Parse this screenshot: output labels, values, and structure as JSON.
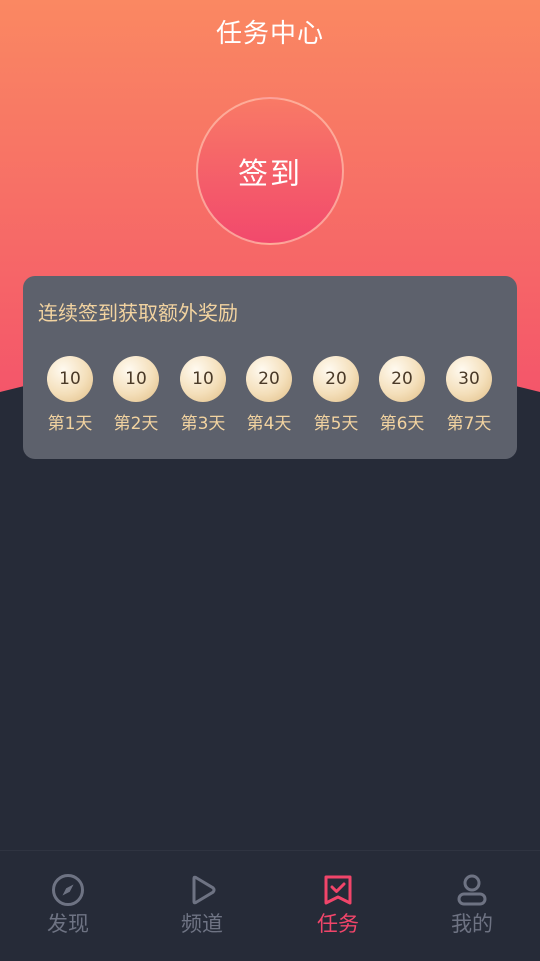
{
  "header": {
    "title": "任务中心"
  },
  "sign_in": {
    "label": "签到"
  },
  "reward": {
    "title": "连续签到获取额外奖励",
    "days": [
      {
        "points": "10",
        "label": "第1天"
      },
      {
        "points": "10",
        "label": "第2天"
      },
      {
        "points": "10",
        "label": "第3天"
      },
      {
        "points": "20",
        "label": "第4天"
      },
      {
        "points": "20",
        "label": "第5天"
      },
      {
        "points": "20",
        "label": "第6天"
      },
      {
        "points": "30",
        "label": "第7天"
      }
    ]
  },
  "tabbar": {
    "items": [
      {
        "label": "发现",
        "icon": "compass-icon",
        "active": false
      },
      {
        "label": "频道",
        "icon": "play-icon",
        "active": false
      },
      {
        "label": "任务",
        "icon": "task-check-icon",
        "active": true
      },
      {
        "label": "我的",
        "icon": "user-icon",
        "active": false
      }
    ]
  },
  "colors": {
    "header_gradient_top": "#fa8862",
    "header_gradient_bottom": "#f4566a",
    "background": "#262b38",
    "card": "#5d616c",
    "gold_text": "#f2d3a0",
    "active_tab": "#f1456a",
    "inactive_tab": "#6e7383"
  }
}
